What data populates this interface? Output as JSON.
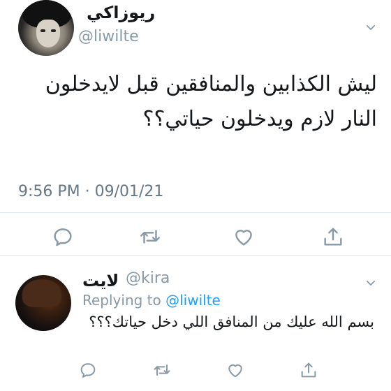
{
  "tweet": {
    "display_name": "ريوزاكي",
    "handle": "@liwilte",
    "text": "ليش الكذابين والمنافقين قبل لايدخلون النار لازم ويدخلون حياتي؟؟",
    "timestamp": "9:56 PM · 09/01/21",
    "actions": [
      "reply-icon",
      "retweet-icon",
      "like-icon",
      "share-icon"
    ]
  },
  "reply": {
    "display_name": "لايت",
    "handle": "@kira",
    "replying_prefix": "Replying to ",
    "replying_to": "@liwilte",
    "text": "بسم الله عليك من المنافق اللي دخل حياتك؟؟؟",
    "actions": [
      "reply-icon",
      "retweet-icon",
      "like-icon",
      "share-icon"
    ]
  },
  "colors": {
    "text": "#14171a",
    "muted": "#8899a6",
    "link": "#1da1f2",
    "divider": "#e1e8ed"
  }
}
